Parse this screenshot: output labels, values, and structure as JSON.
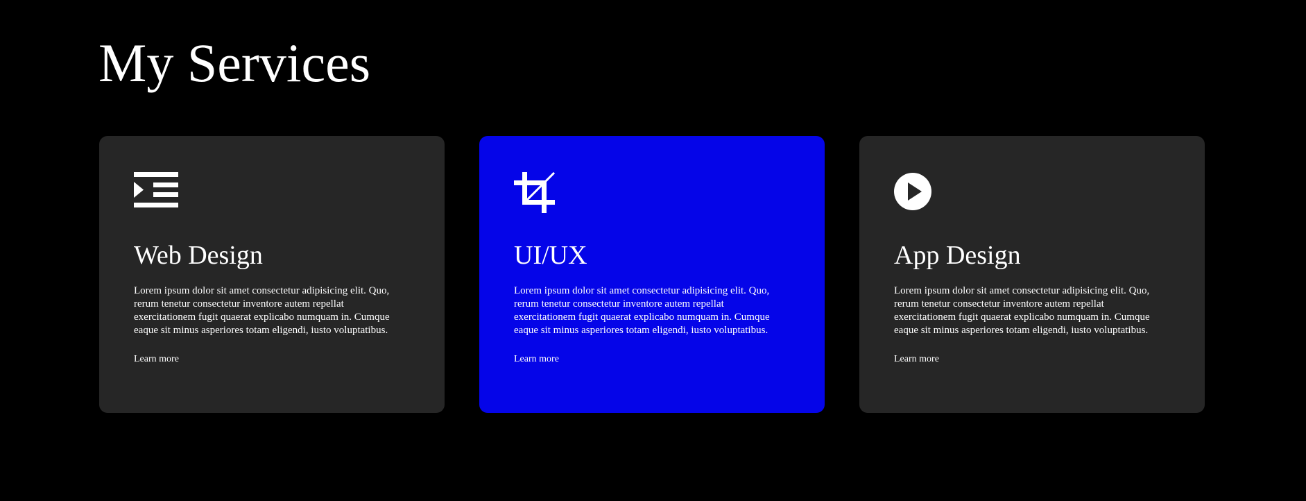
{
  "page": {
    "title": "My Services"
  },
  "colors": {
    "background": "#000000",
    "card": "#262626",
    "card_highlight": "#0505e8",
    "text": "#ffffff"
  },
  "services": [
    {
      "icon": "indent-list-icon",
      "title": "Web Design",
      "text": "Lorem ipsum dolor sit amet consectetur adipisicing elit. Quo, rerum tenetur consectetur inventore autem repellat exercitationem fugit quaerat explicabo numquam in. Cumque eaque sit minus asperiores totam eligendi, iusto voluptatibus.",
      "link": "Learn more",
      "highlighted": false
    },
    {
      "icon": "crop-icon",
      "title": "UI/UX",
      "text": "Lorem ipsum dolor sit amet consectetur adipisicing elit. Quo, rerum tenetur consectetur inventore autem repellat exercitationem fugit quaerat explicabo numquam in. Cumque eaque sit minus asperiores totam eligendi, iusto voluptatibus.",
      "link": "Learn more",
      "highlighted": true
    },
    {
      "icon": "play-circle-icon",
      "title": "App Design",
      "text": "Lorem ipsum dolor sit amet consectetur adipisicing elit. Quo, rerum tenetur consectetur inventore autem repellat exercitationem fugit quaerat explicabo numquam in. Cumque eaque sit minus asperiores totam eligendi, iusto voluptatibus.",
      "link": "Learn more",
      "highlighted": false
    }
  ]
}
